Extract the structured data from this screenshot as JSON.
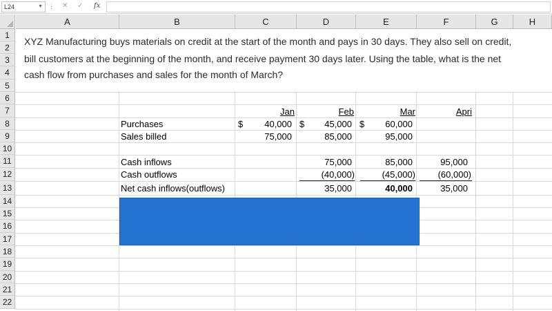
{
  "formula_bar": {
    "name_box": "L24",
    "fx_label": "fx",
    "formula_value": ""
  },
  "columns": [
    "A",
    "B",
    "C",
    "D",
    "E",
    "F",
    "G",
    "H"
  ],
  "rows": [
    "1",
    "2",
    "3",
    "4",
    "5",
    "6",
    "7",
    "8",
    "9",
    "10",
    "11",
    "12",
    "13",
    "14",
    "15",
    "16",
    "17",
    "18",
    "19",
    "20",
    "21",
    "22"
  ],
  "question": {
    "line1": "XYZ Manufacturing buys materials on credit at the start of the month and pays in 30 days. They also sell on credit,",
    "line2": "bill customers at the beginning of the month, and receive payment 30 days later. Using the table, what is the net",
    "line3": "cash flow from purchases and sales for the month of March?"
  },
  "table": {
    "months": {
      "jan": "Jan",
      "feb": "Feb",
      "mar": "Mar",
      "apr": "Apri"
    },
    "currency": "$",
    "purchases": {
      "label": "Purchases",
      "jan": "40,000",
      "feb": "45,000",
      "mar": "60,000"
    },
    "sales_billed": {
      "label": "Sales billed",
      "jan": "75,000",
      "feb": "85,000",
      "mar": "95,000"
    },
    "cash_inflows": {
      "label": "Cash inflows",
      "feb": "75,000",
      "mar": "85,000",
      "apr": "95,000"
    },
    "cash_outflows": {
      "label": "Cash outflows",
      "feb": "(40,000)",
      "mar": "(45,000)",
      "apr": "(60,000)"
    },
    "net": {
      "label": "Net cash inflows(outflows)",
      "feb": "35,000",
      "mar": "40,000",
      "apr": "35,000"
    }
  },
  "answer_box": {
    "color": "#2472d1"
  },
  "colors": {
    "header_bg": "#e6e6e6",
    "gridline": "#d9d9d9"
  }
}
